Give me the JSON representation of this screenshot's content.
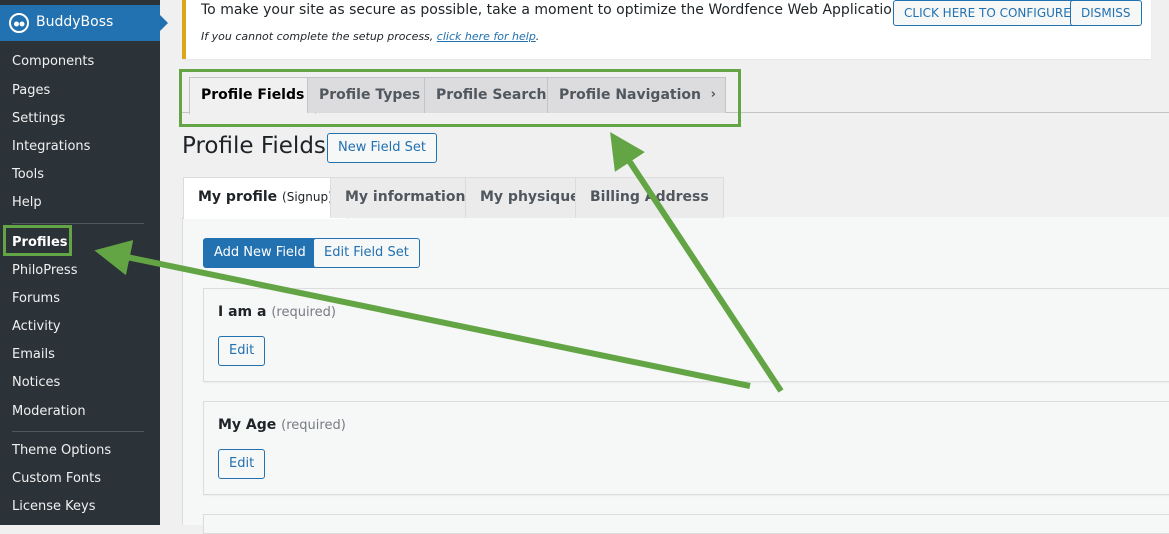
{
  "sidebar": {
    "brand": "BuddyBoss",
    "logo_icon": "buddyboss-logo-icon",
    "items": [
      "Components",
      "Pages",
      "Settings",
      "Integrations",
      "Tools",
      "Help",
      "Profiles",
      "PhiloPress",
      "Forums",
      "Activity",
      "Emails",
      "Notices",
      "Moderation",
      "Theme Options",
      "Custom Fonts",
      "License Keys"
    ],
    "active_item": "Profiles"
  },
  "notice": {
    "message": "To make your site as secure as possible, take a moment to optimize the Wordfence Web Application Firewall:",
    "sub_prefix": "If you cannot complete the setup process, ",
    "sub_link": "click here for help",
    "sub_suffix": ".",
    "configure_button": "CLICK HERE TO CONFIGURE",
    "dismiss_button": "DISMISS",
    "border_color": "#dba617"
  },
  "top_tabs": [
    "Profile Fields",
    "Profile Types",
    "Profile Search",
    "Profile Navigation"
  ],
  "active_top_tab": "Profile Fields",
  "page": {
    "title": "Profile Fields",
    "new_field_set_button": "New Field Set"
  },
  "field_set_tabs": [
    {
      "label": "My profile",
      "sub": "(Signup)"
    },
    {
      "label": "My informations",
      "sub": ""
    },
    {
      "label": "My physique",
      "sub": ""
    },
    {
      "label": "Billing Address",
      "sub": ""
    }
  ],
  "actions": {
    "add_new_field": "Add New Field",
    "edit_field_set": "Edit Field Set"
  },
  "fields": [
    {
      "label": "I am a",
      "required": "(required)",
      "edit": "Edit"
    },
    {
      "label": "My Age",
      "required": "(required)",
      "edit": "Edit"
    }
  ],
  "colors": {
    "highlight": "#63a544",
    "primary": "#2271b1",
    "sidebar": "#2c3338"
  }
}
